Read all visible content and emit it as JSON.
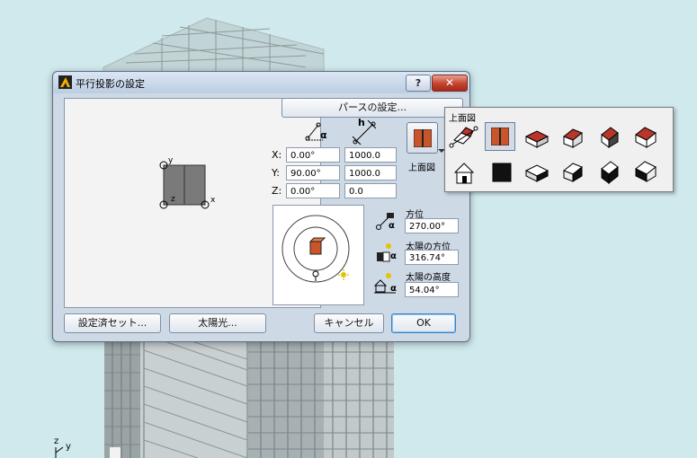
{
  "dialog": {
    "title": "平行投影の設定",
    "help_label": "?",
    "close_label": "✕",
    "perspective_button": "パースの設定...",
    "fields": {
      "x_label": "X:",
      "y_label": "Y:",
      "z_label": "Z:",
      "x_angle": "0.00°",
      "x_dist": "1000.0",
      "y_angle": "90.00°",
      "y_dist": "1000.0",
      "z_angle": "0.00°",
      "z_dist": "0.0"
    },
    "alpha_glyph": "α",
    "h_glyph": "h",
    "view_label": "上面図",
    "preview_axes": {
      "y": "y",
      "z": "z",
      "x": "x"
    },
    "sun": {
      "azimuth_label": "方位",
      "azimuth_value": "270.00°",
      "sun_azimuth_label": "太陽の方位",
      "sun_azimuth_value": "316.74°",
      "sun_altitude_label": "太陽の高度",
      "sun_altitude_value": "54.04°"
    },
    "buttons": {
      "presets": "設定済セット...",
      "sunlight": "太陽光...",
      "cancel": "キャンセル",
      "ok": "OK"
    }
  },
  "popup": {
    "title": "上面図",
    "icons_row1": [
      "axonometric-house-icon",
      "top-view-icon",
      "iso-house-left-icon",
      "iso-house-front-icon",
      "iso-house-right-icon",
      "iso-house-back-icon"
    ],
    "icons_row2": [
      "front-elevation-house-icon",
      "bottom-view-icon",
      "under-iso-left-icon",
      "under-iso-front-icon",
      "under-iso-right-icon",
      "under-iso-back-icon"
    ]
  },
  "corner_axes": {
    "z": "z",
    "y": "y"
  },
  "colors": {
    "accent_orange": "#c8562a",
    "roof_red": "#b8362a",
    "titlebar": "#c9d7e8",
    "sun_yellow": "#e6c200"
  }
}
